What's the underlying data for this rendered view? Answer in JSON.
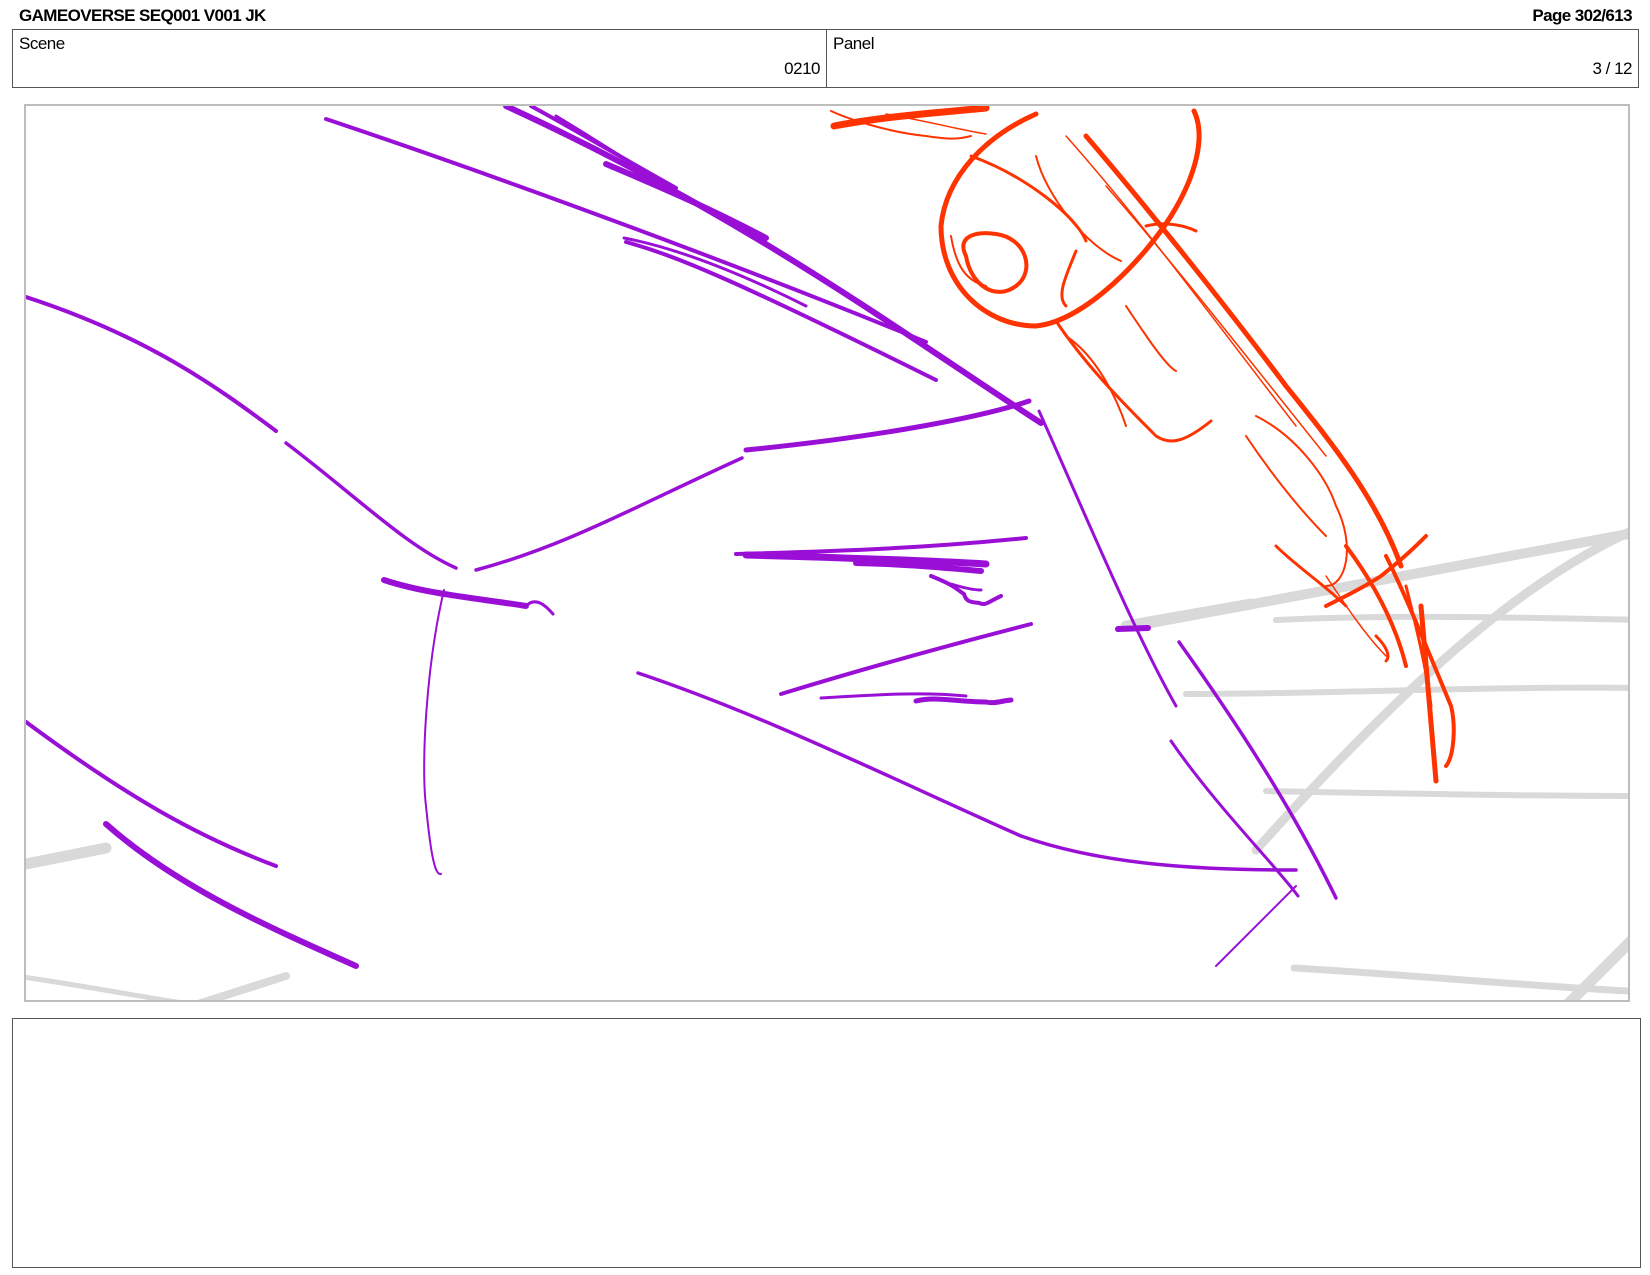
{
  "header": {
    "title": "GAMEOVERSE SEQ001 V001 JK",
    "page": "Page 302/613"
  },
  "scene": {
    "label": "Scene",
    "value": "0210"
  },
  "panel": {
    "label": "Panel",
    "value": "3 / 12"
  },
  "notes": {
    "text": ""
  },
  "colors": {
    "primary_stroke": "#9a0fd6",
    "secondary_stroke": "#ff3300",
    "background_lines": "#d9d9d9",
    "frame_border": "#bdbdbd"
  }
}
